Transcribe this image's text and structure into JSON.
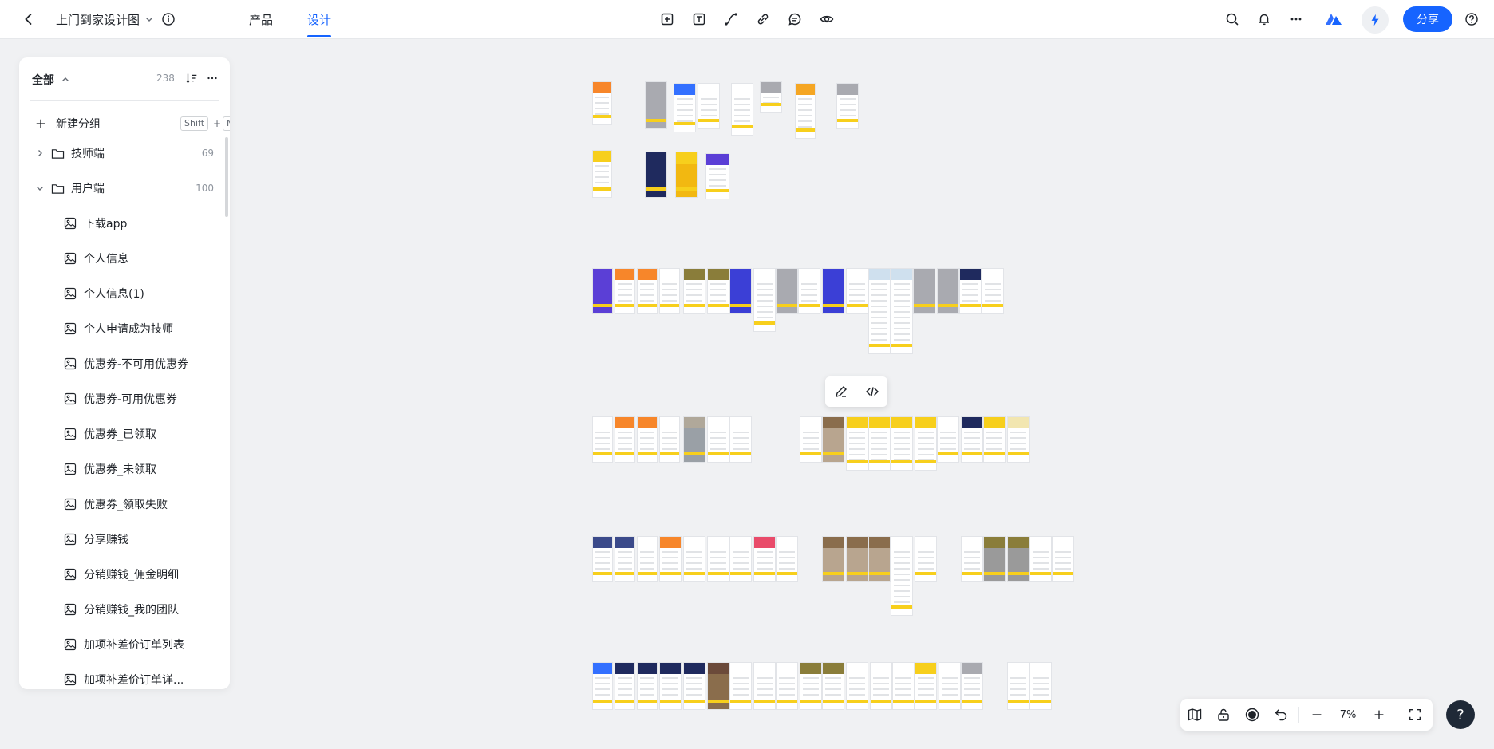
{
  "header": {
    "project_title": "上门到家设计图",
    "tabs": [
      {
        "label": "产品",
        "active": false
      },
      {
        "label": "设计",
        "active": true
      }
    ],
    "share_label": "分享",
    "toolbar_icons": [
      "frame-icon",
      "text-icon",
      "connector-icon",
      "link-icon",
      "comment-icon",
      "preview-icon"
    ],
    "right_icons": [
      "search-icon",
      "bell-icon",
      "more-icon",
      "brand-logo-icon",
      "bolt-icon",
      "help-icon"
    ]
  },
  "sidebar": {
    "title": "全部",
    "total_count": "238",
    "new_group": {
      "label": "新建分组",
      "shortcut_1": "Shift",
      "plus": "+",
      "shortcut_2": "N"
    },
    "groups": [
      {
        "label": "技师端",
        "count": "69",
        "expanded": false
      },
      {
        "label": "用户端",
        "count": "100",
        "expanded": true
      }
    ],
    "pages": [
      "下载app",
      "个人信息",
      "个人信息(1)",
      "个人申请成为技师",
      "优惠券-不可用优惠券",
      "优惠券-可用优惠券",
      "优惠券_已领取",
      "优惠券_未领取",
      "优惠券_领取失败",
      "分享赚钱",
      "分销赚钱_佣金明细",
      "分销赚钱_我的团队",
      "加项补差价订单列表",
      "加项补差价订单详..."
    ]
  },
  "canvas": {
    "zoom": "7%",
    "floating_tools": [
      "edit-icon",
      "code-icon"
    ],
    "colors": {
      "accent": "#1664ff",
      "yellow": "#f7cf1c",
      "orange": "#f7862a",
      "purple": "#5b3fd6",
      "navy": "#1f2a5e"
    }
  },
  "bottom_toolbar": {
    "zoom_label": "7%",
    "help": "?"
  }
}
